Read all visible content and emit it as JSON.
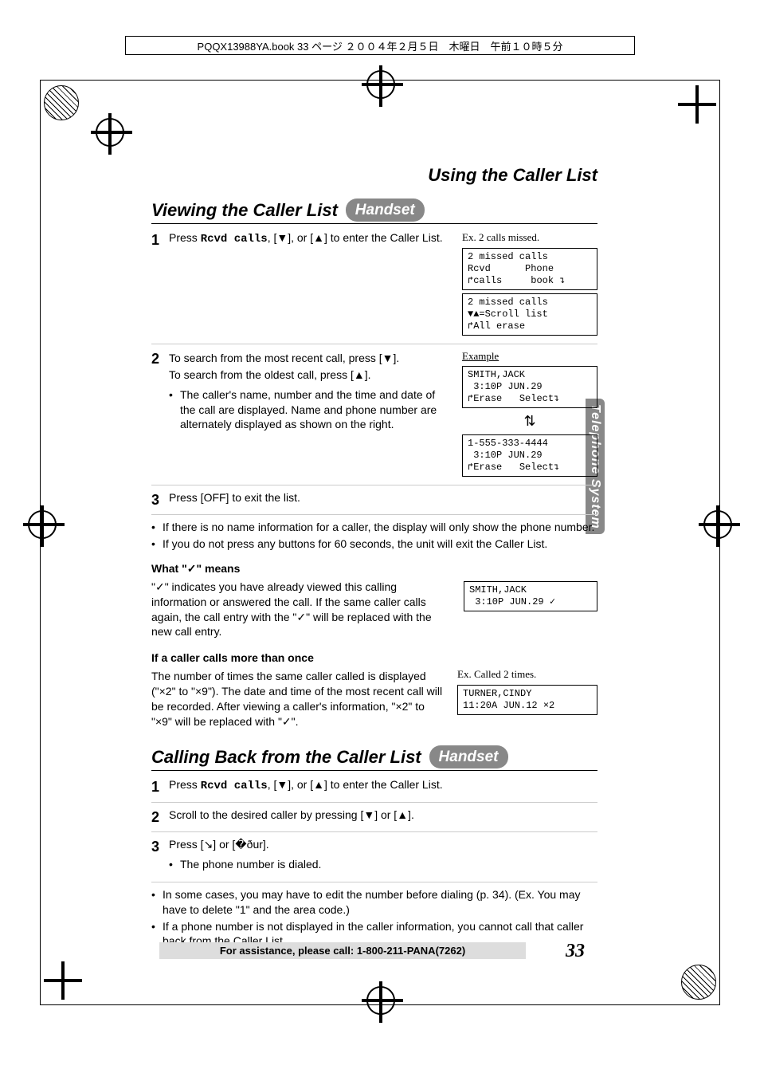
{
  "book_header": "PQQX13988YA.book  33 ページ  ２００４年２月５日　木曜日　午前１０時５分",
  "page_title_right": "Using the Caller List",
  "side_tab": "Telephone System",
  "section1": {
    "title": "Viewing the Caller List",
    "badge": "Handset",
    "step1": {
      "num": "1",
      "text_a": "Press ",
      "mono": "Rcvd calls",
      "text_b": ", [▼], or [▲] to enter the Caller List.",
      "side_caption": "Ex. 2 calls missed.",
      "box1": "2 missed calls\nRcvd      Phone\n↱calls     book ↴",
      "box2": "2 missed calls\n▼▲=Scroll list\n↱All erase"
    },
    "step2": {
      "num": "2",
      "line1": "To search from the most recent call, press [▼].",
      "line2": "To search from the oldest call, press [▲].",
      "bullet": "The caller's name, number and the time and date of the call are displayed. Name and phone number are alternately displayed as shown on the right.",
      "side_caption": "Example",
      "boxA": "SMITH,JACK\n 3:10P JUN.29\n↱Erase   Select↴",
      "boxB": "1-555-333-4444\n 3:10P JUN.29\n↱Erase   Select↴"
    },
    "step3": {
      "num": "3",
      "text": "Press [OFF] to exit the list."
    },
    "notes": {
      "b1": "If there is no name information for a caller, the display will only show the phone number.",
      "b2": "If you do not press any buttons for 60 seconds, the unit will exit the Caller List."
    },
    "check_h": "What \"✓\" means",
    "check_p": "\"✓\" indicates you have already viewed this calling information or answered the call. If the same caller calls again, the call entry with the \"✓\" will be replaced with the new call entry.",
    "check_box": "SMITH,JACK\n 3:10P JUN.29 ✓",
    "multi_h": "If a caller calls more than once",
    "multi_p": "The number of times the same caller called is displayed (\"×2\" to \"×9\"). The date and time of the most recent call will be recorded. After viewing a caller's information, \"×2\" to \"×9\" will be replaced with \"✓\".",
    "multi_caption": "Ex. Called 2 times.",
    "multi_box": "TURNER,CINDY\n11:20A JUN.12 ×2"
  },
  "section2": {
    "title": "Calling Back from the Caller List",
    "badge": "Handset",
    "step1": {
      "num": "1",
      "a": "Press ",
      "mono": "Rcvd calls",
      "b": ", [▼], or [▲] to enter the Caller List."
    },
    "step2": {
      "num": "2",
      "text": "Scroll to the desired caller by pressing [▼] or [▲]."
    },
    "step3": {
      "num": "3",
      "text": "Press [↘] or [�ður].",
      "sub": "The phone number is dialed."
    },
    "notes": {
      "b1": "In some cases, you may have to edit the number before dialing (p. 34). (Ex. You may have to delete \"1\" and the area code.)",
      "b2": "If a phone number is not displayed in the caller information, you cannot call that caller back from the Caller List."
    }
  },
  "assist": "For assistance, please call: 1-800-211-PANA(7262)",
  "page_number": "33"
}
